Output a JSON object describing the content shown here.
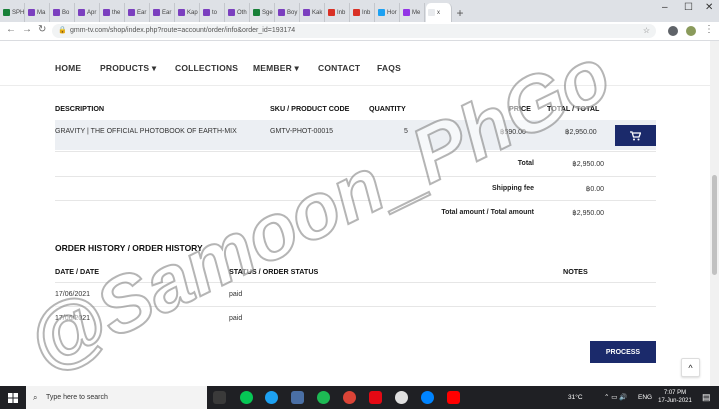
{
  "browser": {
    "tabs": [
      {
        "label": "SPH",
        "color": "#188038"
      },
      {
        "label": "Ma",
        "color": "#7b3fbf"
      },
      {
        "label": "Bo",
        "color": "#7b3fbf"
      },
      {
        "label": "Apr",
        "color": "#7b3fbf"
      },
      {
        "label": "the",
        "color": "#7b3fbf"
      },
      {
        "label": "Ear",
        "color": "#7b3fbf"
      },
      {
        "label": "Ear",
        "color": "#7b3fbf"
      },
      {
        "label": "Kap",
        "color": "#7b3fbf"
      },
      {
        "label": "to",
        "color": "#7b3fbf"
      },
      {
        "label": "Oth",
        "color": "#7b3fbf"
      },
      {
        "label": "Sge",
        "color": "#188038"
      },
      {
        "label": "Boy",
        "color": "#7b3fbf"
      },
      {
        "label": "Kak",
        "color": "#7b3fbf"
      },
      {
        "label": "Inb",
        "color": "#d93025"
      },
      {
        "label": "Inb",
        "color": "#d93025"
      },
      {
        "label": "Hor",
        "color": "#1da1f2"
      },
      {
        "label": "Me",
        "color": "#9334e6"
      },
      {
        "label": "x",
        "color": "#e8eaed",
        "active": true
      }
    ],
    "new_tab": "+",
    "url": "gmm-tv.com/shop/index.php?route=account/order/info&order_id=193174",
    "window_controls": {
      "minimize": "–",
      "maximize": "☐",
      "close": "✕"
    }
  },
  "nav": {
    "home": "HOME",
    "products": "PRODUCTS ▾",
    "collections": "COLLECTIONS",
    "member": "MEMBER ▾",
    "contact": "CONTACT",
    "faqs": "FAQS"
  },
  "order": {
    "headers": {
      "description": "DESCRIPTION",
      "sku": "SKU / PRODUCT CODE",
      "quantity": "QUANTITY",
      "price": "PRICE",
      "total": "TOTAL / TOTAL"
    },
    "items": [
      {
        "description": "GRAVITY | THE OFFICIAL PHOTOBOOK OF EARTH-MIX",
        "sku": "GMTV-PHOT-00015",
        "quantity": "5",
        "price": "฿590.00",
        "total": "฿2,950.00"
      }
    ],
    "summary": [
      {
        "label": "Total",
        "value": "฿2,950.00"
      },
      {
        "label": "Shipping fee",
        "value": "฿0.00"
      },
      {
        "label": "Total amount / Total amount",
        "value": "฿2,950.00"
      }
    ]
  },
  "history": {
    "title": "ORDER HISTORY / ORDER HISTORY",
    "headers": {
      "date": "DATE / DATE",
      "status": "STATUS / ORDER STATUS",
      "notes": "NOTES"
    },
    "rows": [
      {
        "date": "17/06/2021",
        "status": "paid"
      },
      {
        "date": "17/06/2021",
        "status": "paid"
      }
    ]
  },
  "process_button": "PROCESS",
  "scroll_top_icon": "^",
  "watermark": "@Samoon_PhGo",
  "taskbar": {
    "search_placeholder": "Type here to search",
    "weather": "31°C",
    "tray_text": "ENG",
    "time": "7:07 PM",
    "date": "17-Jun-2021"
  }
}
